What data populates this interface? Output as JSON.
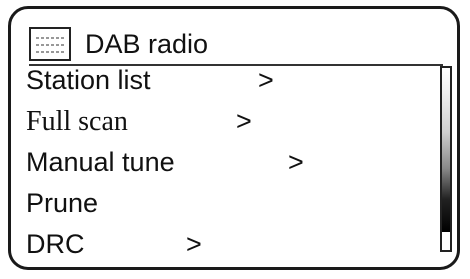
{
  "header": {
    "title": "DAB radio",
    "icon": "radio-display-icon"
  },
  "menu": {
    "items": [
      {
        "label": "Station list",
        "arrow": ">"
      },
      {
        "label": "Full scan",
        "arrow": ">"
      },
      {
        "label": "Manual tune",
        "arrow": ">"
      },
      {
        "label": "Prune",
        "arrow": ""
      },
      {
        "label": "DRC",
        "arrow": ">"
      }
    ]
  },
  "colors": {
    "border": "#1a1a1a",
    "text": "#111111",
    "background": "#ffffff"
  }
}
